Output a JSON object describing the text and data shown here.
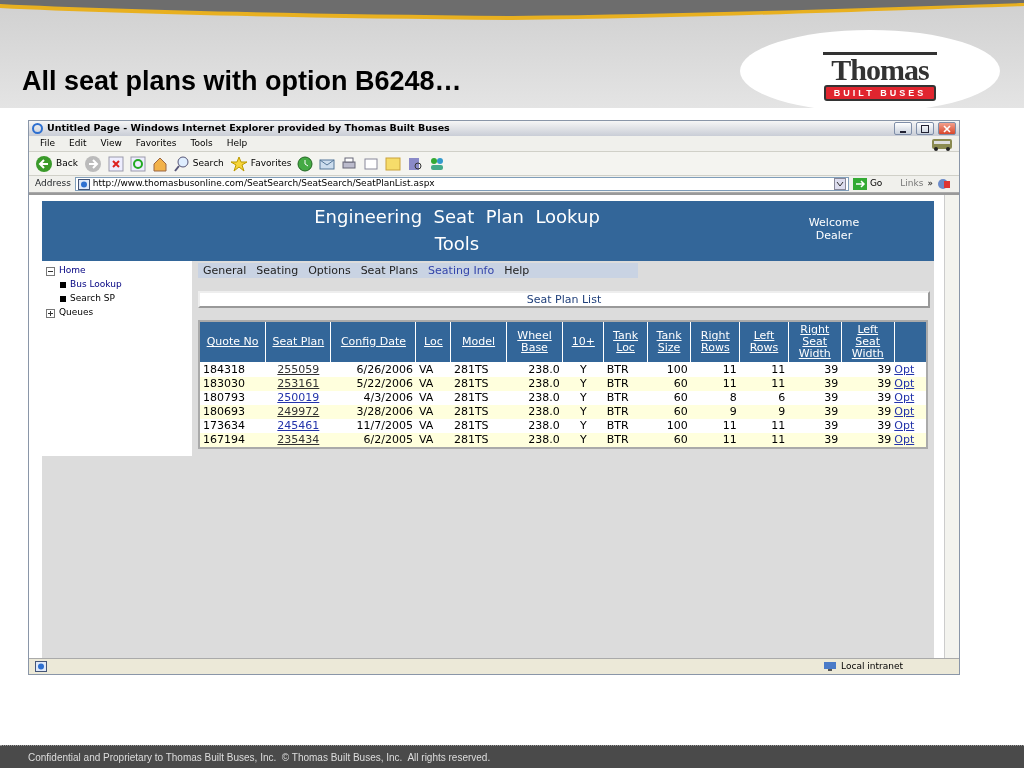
{
  "slide": {
    "title": "All seat plans with option B6248…",
    "logo": {
      "name": "Thomas",
      "tagline": "BUILT BUSES"
    },
    "footer": "Confidential and Proprietary to Thomas Built Buses, Inc.  © Thomas Built Buses, Inc.  All rights reserved."
  },
  "window": {
    "title": "Untitled Page - Windows Internet Explorer provided by Thomas Built Buses"
  },
  "menu": [
    "File",
    "Edit",
    "View",
    "Favorites",
    "Tools",
    "Help"
  ],
  "toolbar": {
    "back": "Back",
    "search": "Search",
    "favorites": "Favorites"
  },
  "address": {
    "label": "Address",
    "url": "http://www.thomasbusonline.com/SeatSearch/SeatSearch/SeatPlanList.aspx",
    "go": "Go",
    "links": "Links",
    "more": "»"
  },
  "page": {
    "heading": "Engineering  Seat  Plan  Lookup  Tools",
    "welcome": "Welcome Dealer",
    "sidebar": [
      {
        "label": "Home",
        "expanded": true,
        "children": [
          {
            "label": "Bus Lookup",
            "visited": true
          },
          {
            "label": "Search SP",
            "visited": false
          }
        ]
      },
      {
        "label": "Queues",
        "expanded": false
      }
    ],
    "nav": [
      {
        "label": "General",
        "selected": false
      },
      {
        "label": "Seating",
        "selected": false
      },
      {
        "label": "Options",
        "selected": false
      },
      {
        "label": "Seat Plans",
        "selected": false
      },
      {
        "label": "Seating Info",
        "selected": true
      },
      {
        "label": "Help",
        "selected": false
      }
    ],
    "section_title": "Seat Plan List",
    "table": {
      "columns": [
        "Quote No",
        "Seat Plan",
        "Config Date",
        "Loc",
        "Model",
        "Wheel Base",
        "10+",
        "Tank Loc",
        "Tank Size",
        "Right Rows",
        "Left Rows",
        "Right Seat Width",
        "Left Seat Width"
      ],
      "rows": [
        {
          "cells": [
            "184318",
            "255059",
            "6/26/2006",
            "VA",
            "281TS",
            "238.0",
            "Y",
            "BTR",
            "100",
            "11",
            "11",
            "39",
            "39"
          ],
          "visited": true,
          "link": "Opt"
        },
        {
          "cells": [
            "183030",
            "253161",
            "5/22/2006",
            "VA",
            "281TS",
            "238.0",
            "Y",
            "BTR",
            "60",
            "11",
            "11",
            "39",
            "39"
          ],
          "visited": true,
          "link": "Opt"
        },
        {
          "cells": [
            "180793",
            "250019",
            "4/3/2006",
            "VA",
            "281TS",
            "238.0",
            "Y",
            "BTR",
            "60",
            "8",
            "6",
            "39",
            "39"
          ],
          "visited": false,
          "link": "Opt"
        },
        {
          "cells": [
            "180693",
            "249972",
            "3/28/2006",
            "VA",
            "281TS",
            "238.0",
            "Y",
            "BTR",
            "60",
            "9",
            "9",
            "39",
            "39"
          ],
          "visited": true,
          "link": "Opt"
        },
        {
          "cells": [
            "173634",
            "245461",
            "11/7/2005",
            "VA",
            "281TS",
            "238.0",
            "Y",
            "BTR",
            "100",
            "11",
            "11",
            "39",
            "39"
          ],
          "visited": false,
          "link": "Opt"
        },
        {
          "cells": [
            "167194",
            "235434",
            "6/2/2005",
            "VA",
            "281TS",
            "238.0",
            "Y",
            "BTR",
            "60",
            "11",
            "11",
            "39",
            "39"
          ],
          "visited": true,
          "link": "Opt"
        }
      ]
    }
  },
  "status_bar": {
    "zone": "Local intranet"
  }
}
